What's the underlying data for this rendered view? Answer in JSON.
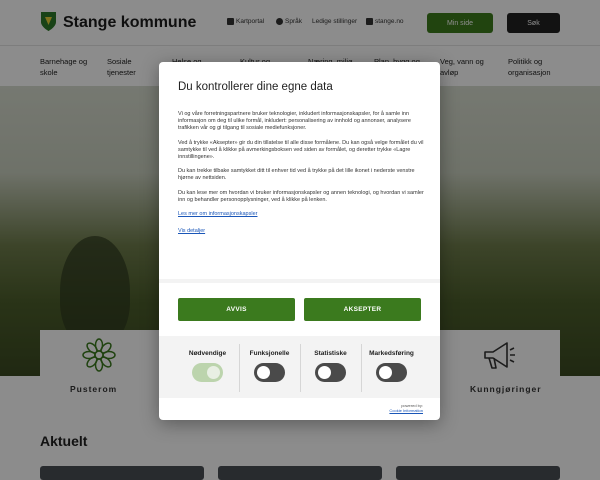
{
  "header": {
    "brand": "Stange kommune",
    "util_links": [
      "Kartportal",
      "Språk",
      "Ledige stillinger",
      "stange.no"
    ],
    "mine_side_label": "Min side",
    "search_label": "Søk"
  },
  "nav": {
    "items": [
      "Barnehage og skole",
      "Sosiale tjenester",
      "Helse og",
      "Kultur og",
      "Næring, miljø",
      "Plan, bygg og",
      "Veg, vann og avløp",
      "Politikk og organisasjon"
    ]
  },
  "cards": [
    {
      "label": "Pusterom",
      "icon": "flower-icon"
    },
    {
      "label": "Kunngjøringer",
      "icon": "megaphone-icon"
    }
  ],
  "section": {
    "title": "Aktuelt"
  },
  "dialog": {
    "title": "Du kontrollerer dine egne data",
    "paragraphs": [
      "Vi og våre forretningspartnere bruker teknologier, inkludert informasjonskapsler, for å samle inn informasjon om deg til ulike formål, inkludert: personalisering av innhold og annonser, analysere trafikken vår og gi tilgang til sosiale mediefunksjoner.",
      "Ved å trykke «Aksepter» gir du din tillatelse til alle disse formålene. Du kan også velge formålet du vil samtykke til ved å klikke på avmerkingsboksen ved siden av formålet, og deretter trykke «Lagre innstillingene».",
      "Du kan trekke tilbake samtykket ditt til enhver tid ved å trykke på det lille ikonet i nederste venstre hjørne av nettsiden.",
      "Du kan lese mer om hvordan vi bruker informasjonskapsler og annen teknologi, og hvordan vi samler inn og behandler personopplysninger, ved å klikke på lenken."
    ],
    "link_more": "Les mer om informasjonskapsler",
    "link_details": "Vis detaljer",
    "reject_label": "AVVIS",
    "accept_label": "AKSEPTER",
    "preferences": [
      {
        "label": "Nødvendige",
        "enabled": true
      },
      {
        "label": "Funksjonelle",
        "enabled": false
      },
      {
        "label": "Statistiske",
        "enabled": false
      },
      {
        "label": "Markedsføring",
        "enabled": false
      }
    ],
    "powered_by": "powered by:",
    "powered_brand": "Cookie Information"
  },
  "colors": {
    "accent_green": "#3b7a1e",
    "toggle_off": "#4a4a4a",
    "toggle_on": "#bcd4ad",
    "link": "#1a56b8"
  }
}
